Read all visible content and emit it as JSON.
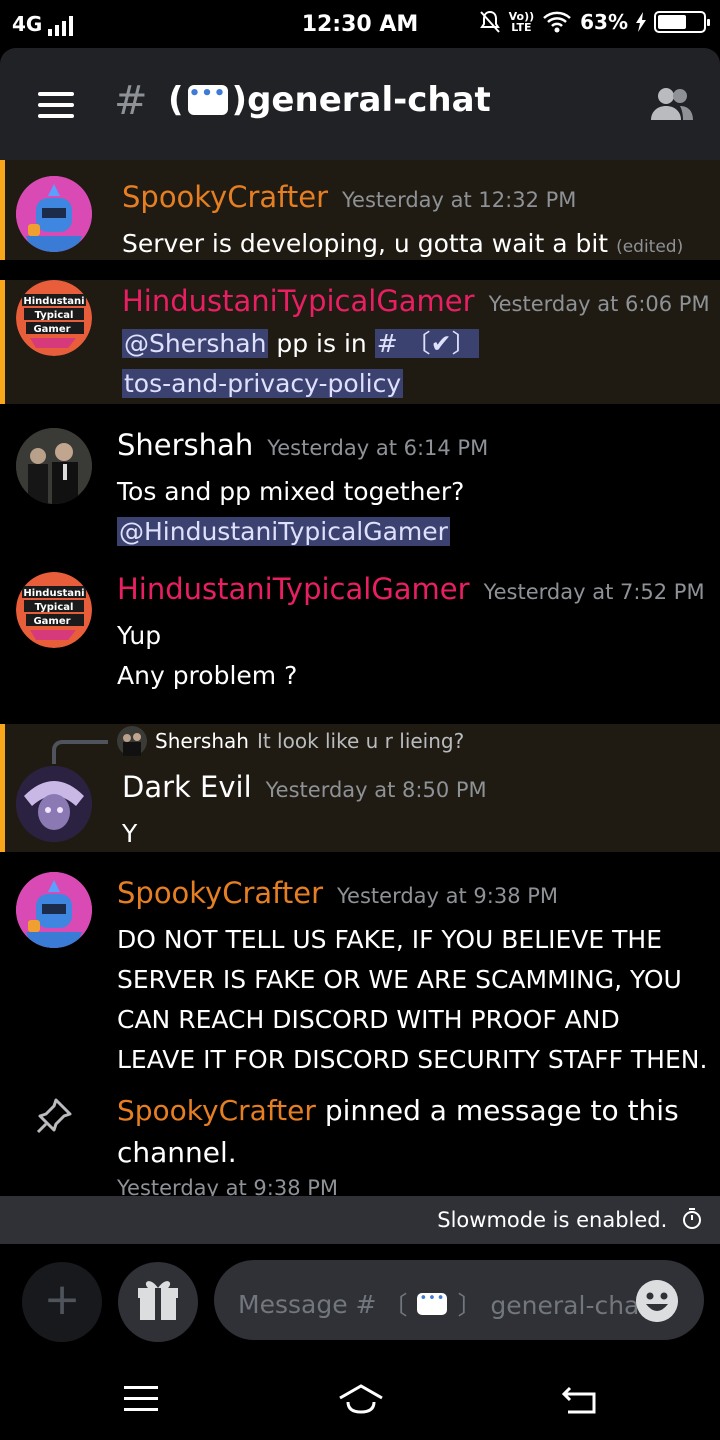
{
  "status_bar": {
    "network": "4G",
    "time": "12:30 AM",
    "volte_top": "Vo))",
    "volte_bottom": "LTE",
    "battery_percent": "63%",
    "battery_level": 0.63
  },
  "header": {
    "hash": "#",
    "channel_prefix": "(",
    "channel_suffix": ")general-chat"
  },
  "messages": [
    {
      "author": "SpookyCrafter",
      "time": "Yesterday at 12:32 PM",
      "text": "Server is developing, u gotta wait a bit",
      "edited": "(edited)",
      "author_color": "#e67e22"
    },
    {
      "author": "HindustaniTypicalGamer",
      "time": "Yesterday at 6:06 PM",
      "mention": "@Shershah",
      "text_mid": "pp is in",
      "channel_hash": "#",
      "channel_prefix": "〔✔〕",
      "channel_name": "tos-and-privacy-policy",
      "author_color": "#e91e63"
    },
    {
      "author": "Shershah",
      "time": "Yesterday at 6:14 PM",
      "line1": "Tos and pp mixed together?",
      "mention": "@HindustaniTypicalGamer"
    },
    {
      "author": "HindustaniTypicalGamer",
      "time": "Yesterday at 7:52 PM",
      "line1": "Yup",
      "line2": "Any problem ?"
    },
    {
      "reply_author": "Shershah",
      "reply_text": "It look like u r lieing?",
      "author": "Dark Evil",
      "time": "Yesterday at 8:50 PM",
      "text": "Y"
    },
    {
      "author": "SpookyCrafter",
      "time": "Yesterday at 9:38 PM",
      "lines": [
        "DO NOT TELL US FAKE, IF YOU BELIEVE THE",
        "SERVER IS FAKE OR WE ARE SCAMMING, YOU",
        "CAN REACH DISCORD WITH PROOF AND",
        "LEAVE IT FOR DISCORD SECURITY STAFF THEN."
      ]
    }
  ],
  "system_message": {
    "author": "SpookyCrafter",
    "text_line1": "pinned a message to this",
    "text_line2": "channel.",
    "time": "Yesterday at 9:38 PM"
  },
  "avatar_labels": {
    "hindustani": [
      "Hindustani",
      "Typical",
      "Gamer"
    ]
  },
  "slowmode": {
    "text": "Slowmode is enabled."
  },
  "composer": {
    "placeholder_start": "Message #",
    "placeholder_prefix": "〔",
    "placeholder_suffix": "〕 general-chat"
  },
  "colors": {
    "accent_orange": "#e67e22",
    "accent_pink": "#e91e63",
    "mention_bar": "#faa61a",
    "mention_bg": "#1f1b12",
    "header_bg": "#202225"
  }
}
